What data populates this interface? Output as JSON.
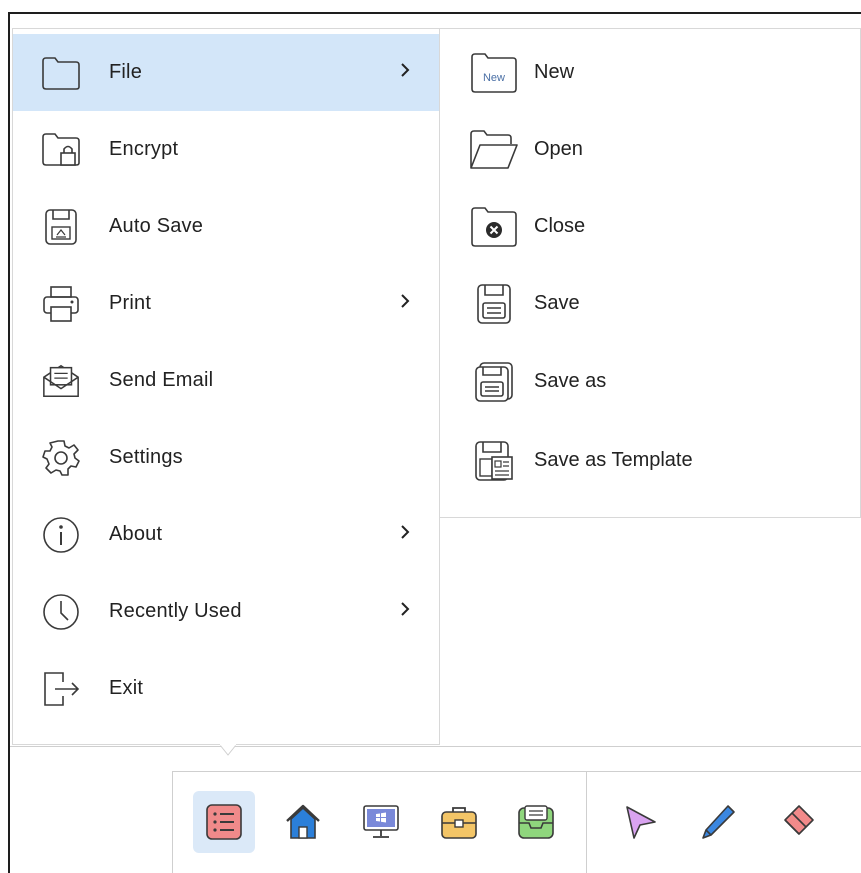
{
  "menu": {
    "items": [
      {
        "label": "File",
        "icon": "folder-icon",
        "has_submenu": true,
        "active": true
      },
      {
        "label": "Encrypt",
        "icon": "folder-lock-icon",
        "has_submenu": false
      },
      {
        "label": "Auto Save",
        "icon": "auto-save-icon",
        "has_submenu": false
      },
      {
        "label": "Print",
        "icon": "printer-icon",
        "has_submenu": true
      },
      {
        "label": "Send Email",
        "icon": "email-icon",
        "has_submenu": false
      },
      {
        "label": "Settings",
        "icon": "gear-icon",
        "has_submenu": false
      },
      {
        "label": "About",
        "icon": "info-icon",
        "has_submenu": true
      },
      {
        "label": "Recently Used",
        "icon": "clock-icon",
        "has_submenu": true
      },
      {
        "label": "Exit",
        "icon": "exit-icon",
        "has_submenu": false
      }
    ]
  },
  "submenu": {
    "new_badge": "New",
    "items": [
      {
        "label": "New",
        "icon": "new-file-icon"
      },
      {
        "label": "Open",
        "icon": "open-folder-icon"
      },
      {
        "label": "Close",
        "icon": "close-file-icon"
      },
      {
        "label": "Save",
        "icon": "save-icon"
      },
      {
        "label": "Save as",
        "icon": "save-as-icon"
      },
      {
        "label": "Save as Template",
        "icon": "save-template-icon"
      }
    ]
  },
  "toolbar": {
    "buttons": [
      {
        "icon": "menu-list-icon",
        "active": true
      },
      {
        "icon": "home-icon"
      },
      {
        "icon": "desktop-icon"
      },
      {
        "icon": "toolbox-icon"
      },
      {
        "icon": "inbox-tray-icon"
      },
      {
        "icon": "pointer-arrow-icon"
      },
      {
        "icon": "pen-icon"
      },
      {
        "icon": "eraser-icon"
      }
    ]
  },
  "colors": {
    "active_bg": "#d3e6f9",
    "border": "#d8d8d8",
    "icon_stroke": "#3a3a3a"
  }
}
